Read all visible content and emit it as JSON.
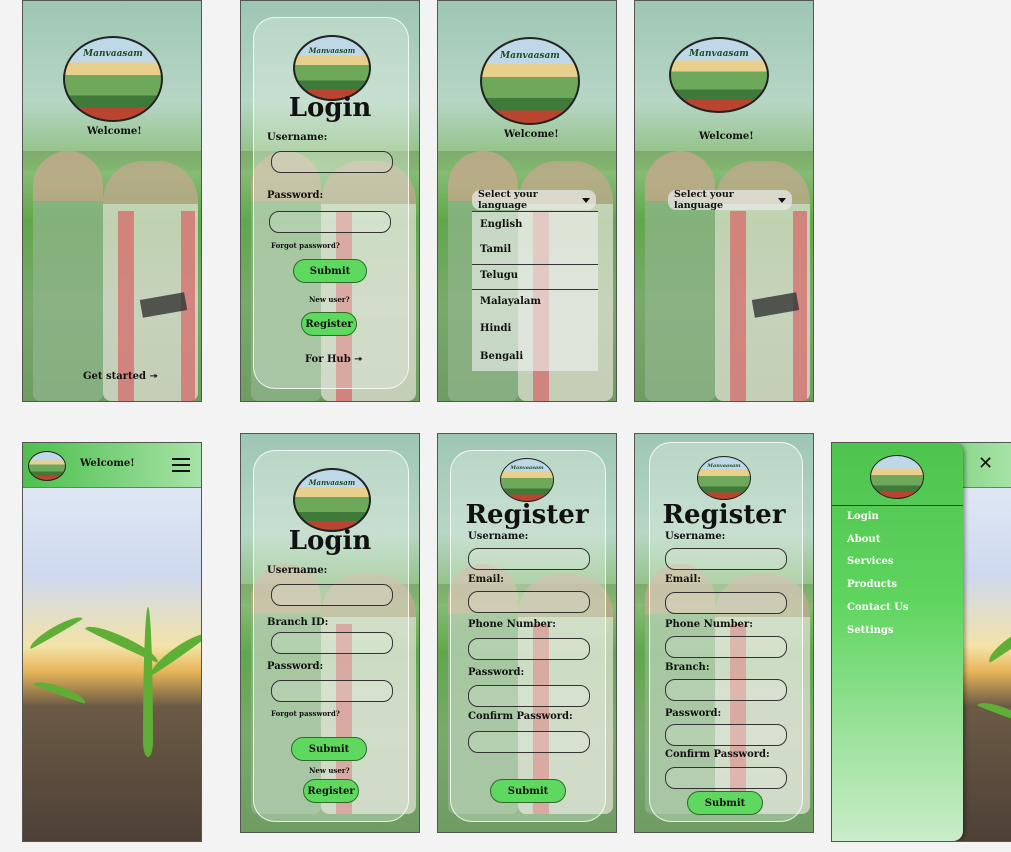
{
  "brand": "Manvaasam",
  "screen1": {
    "welcome": "Welcome!",
    "cta": "Get started ↠"
  },
  "login": {
    "title": "Login",
    "username_label": "Username:",
    "password_label": "Password:",
    "forgot": "Forgot password?",
    "submit": "Submit",
    "new_user": "New user?",
    "register": "Register",
    "for_hub": "For Hub ↠"
  },
  "language": {
    "welcome": "Welcome!",
    "select": "Select your language",
    "options": [
      "English",
      "Tamil",
      "Telugu",
      "Malayalam",
      "Hindi",
      "Bengali"
    ]
  },
  "home": {
    "welcome": "Welcome!"
  },
  "hub_login": {
    "title": "Login",
    "username_label": "Username:",
    "branch_label": "Branch ID:",
    "password_label": "Password:",
    "forgot": "Forgot password?",
    "submit": "Submit",
    "new_user": "New user?",
    "register": "Register"
  },
  "register": {
    "title": "Register",
    "username_label": "Username:",
    "email_label": "Email:",
    "phone_label": "Phone Number:",
    "password_label": "Password:",
    "confirm_label": "Confirm Password:",
    "submit": "Submit"
  },
  "hub_register": {
    "title": "Register",
    "username_label": "Username:",
    "email_label": "Email:",
    "phone_label": "Phone Number:",
    "branch_label": "Branch:",
    "password_label": "Password:",
    "confirm_label": "Confirm Password:",
    "submit": "Submit"
  },
  "menu": {
    "close": "✕",
    "items": [
      "Login",
      "About",
      "Services",
      "Products",
      "Contact Us",
      "Settings"
    ]
  },
  "colors": {
    "accent": "#5ed85e",
    "header": "#4cc04c"
  }
}
